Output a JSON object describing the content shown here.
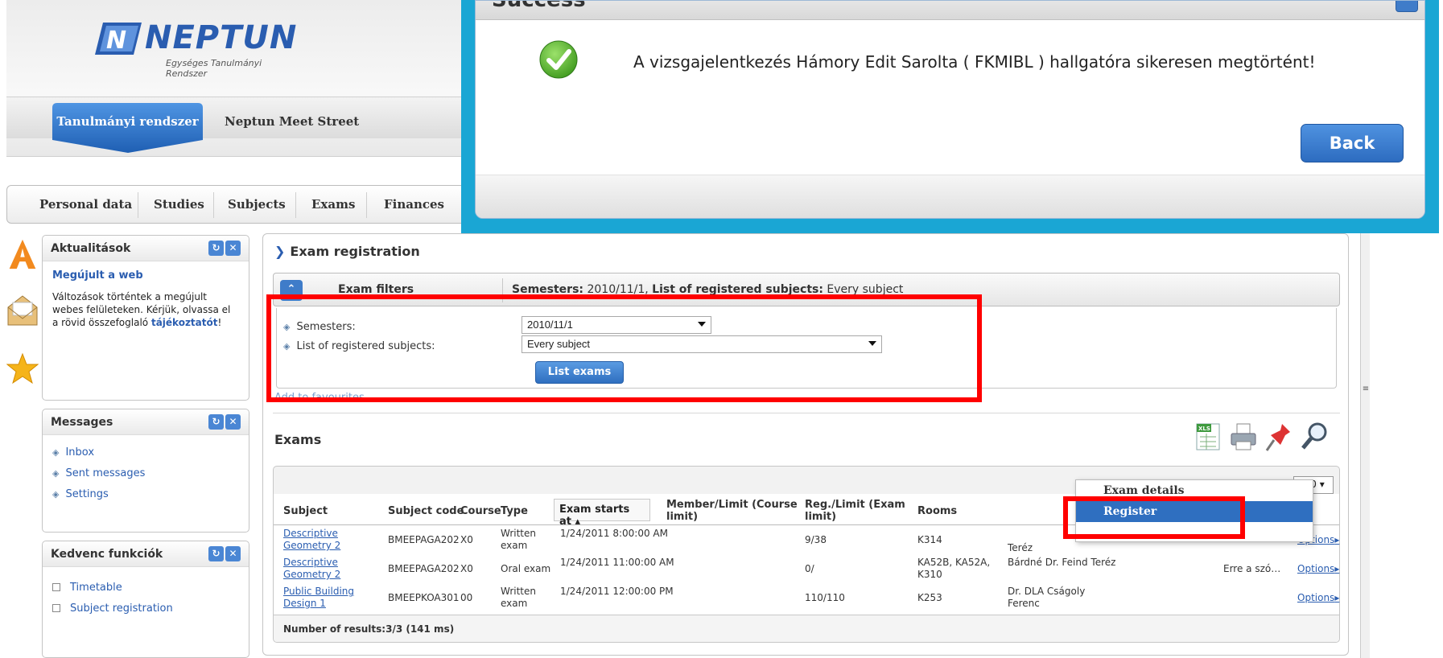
{
  "header": {
    "logo_text": "NEPTUN",
    "logo_subtitle": "Egységes Tanulmányi Rendszer",
    "tabs": [
      {
        "label": "Tanulmányi rendszer",
        "active": true
      },
      {
        "label": "Neptun Meet Street",
        "active": false
      }
    ]
  },
  "nav": {
    "items": [
      "Personal data",
      "Studies",
      "Subjects",
      "Exams",
      "Finances"
    ]
  },
  "sidebar": {
    "news": {
      "title": "Aktualitások",
      "headline": "Megújult a web",
      "body": "Változások történtek a megújult webes felületeken. Kérjük, olvassa el a rövid összefoglaló",
      "link": "tájékoztatót",
      "suffix": "!"
    },
    "messages": {
      "title": "Messages",
      "items": [
        "Inbox",
        "Sent messages",
        "Settings"
      ]
    },
    "favorites": {
      "title": "Kedvenc funkciók",
      "items": [
        "Timetable",
        "Subject registration"
      ]
    }
  },
  "main": {
    "title": "Exam registration",
    "filters": {
      "label": "Exam filters",
      "summary_semesters_label": "Semesters:",
      "summary_semesters_value": "2010/11/1,",
      "summary_subjects_label": "List of registered subjects:",
      "summary_subjects_value": "Every subject",
      "semesters_label": "Semesters:",
      "semesters_value": "2010/11/1",
      "subjects_label": "List of registered subjects:",
      "subjects_value": "Every subject",
      "list_button": "List exams",
      "add_favourites": "Add to favourites"
    },
    "exams": {
      "title": "Exams",
      "pager_value": "500",
      "columns": [
        "Subject",
        "Subject code",
        "Course",
        "Type",
        "Exam starts at",
        "Member/Limit (Course limit)",
        "Reg./Limit (Exam limit)",
        "Rooms"
      ],
      "rows": [
        {
          "subject": "Descriptive Geometry 2",
          "code": "BMEEPAGA202",
          "course": "X0",
          "type": "Written exam",
          "starts": "1/24/2011 8:00:00 AM",
          "member": "",
          "reg": "9/38",
          "rooms": "K314",
          "examiner": "Teréz",
          "note": "",
          "options": "Options"
        },
        {
          "subject": "Descriptive Geometry 2",
          "code": "BMEEPAGA202",
          "course": "X0",
          "type": "Oral exam",
          "starts": "1/24/2011 11:00:00 AM",
          "member": "",
          "reg": "0/",
          "rooms": "KA52B, KA52A, K310",
          "examiner": "Bárdné Dr. Feind Teréz",
          "note": "Erre a szó…",
          "options": "Options"
        },
        {
          "subject": "Public Building Design 1",
          "code": "BMEEPKOA301",
          "course": "00",
          "type": "Written exam",
          "starts": "1/24/2011 12:00:00 PM",
          "member": "",
          "reg": "110/110",
          "rooms": "K253",
          "examiner": "Dr. DLA Cságoly Ferenc",
          "note": "",
          "options": "Options"
        }
      ],
      "results": "Number of results:3/3 (141 ms)"
    },
    "context_menu": {
      "items": [
        "Exam details",
        "Register"
      ]
    }
  },
  "modal": {
    "title": "Success",
    "message": "A vizsgajelentkezés Hámory Edit Sarolta ( FKMIBL ) hallgatóra sikeresen megtörtént!",
    "back_button": "Back"
  },
  "colors": {
    "accent": "#2f6fc0",
    "modal_frame": "#1aa6d4",
    "highlight": "#ff0000",
    "success": "#4caf2a"
  }
}
